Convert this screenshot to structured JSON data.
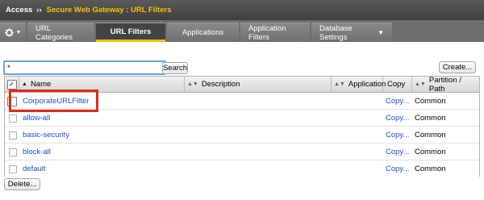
{
  "breadcrumb": {
    "root": "Access",
    "separator": "››",
    "current": "Secure Web Gateway : URL Filters"
  },
  "tabs": [
    {
      "label": "URL Categories",
      "active": false
    },
    {
      "label": "URL Filters",
      "active": true
    },
    {
      "label": "Applications",
      "active": false
    },
    {
      "label": "Application Filters",
      "active": false
    },
    {
      "label": "Database Settings",
      "active": false,
      "has_dropdown": true
    }
  ],
  "gear_menu": {
    "icon": "gear-icon",
    "caret_icon": "caret-down-icon"
  },
  "search": {
    "value": "*",
    "button_label": "Search"
  },
  "create_button_label": "Create...",
  "table": {
    "columns": {
      "select_all": "✓",
      "name": "Name",
      "description": "Description",
      "application": "Application",
      "copy": "Copy",
      "partition": "Partition / Path"
    },
    "rows": [
      {
        "name": "CorporateURLFilter",
        "description": "",
        "copy": "Copy...",
        "partition": "Common"
      },
      {
        "name": "allow-all",
        "description": "",
        "copy": "Copy...",
        "partition": "Common"
      },
      {
        "name": "basic-security",
        "description": "",
        "copy": "Copy...",
        "partition": "Common"
      },
      {
        "name": "block-all",
        "description": "",
        "copy": "Copy...",
        "partition": "Common"
      },
      {
        "name": "default",
        "description": "",
        "copy": "Copy...",
        "partition": "Common"
      }
    ]
  },
  "delete_button_label": "Delete...",
  "colors": {
    "accent_yellow": "#f2c200",
    "link_blue": "#1a4fc8",
    "highlight_red": "#e22a16",
    "topbar_dark": "#434343"
  }
}
